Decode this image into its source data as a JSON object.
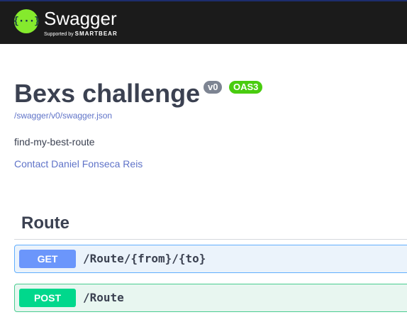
{
  "topbar": {
    "brand": "Swagger",
    "supported_by": "Supported by",
    "company": "SMARTBEAR",
    "logo_glyph": "{···}",
    "logo_color": "#85ea2d",
    "background": "#1b1b1b"
  },
  "info": {
    "title": "Bexs challenge",
    "version_badge": "v0",
    "oas_badge": "OAS3",
    "spec_url": "/swagger/v0/swagger.json",
    "description": "find-my-best-route",
    "contact": "Contact Daniel Fonseca Reis"
  },
  "tags": [
    {
      "name": "Route",
      "operations": [
        {
          "method": "GET",
          "path": "/Route/{from}/{to}",
          "color": "#61affe"
        },
        {
          "method": "POST",
          "path": "/Route",
          "color": "#49cc90"
        }
      ]
    }
  ]
}
